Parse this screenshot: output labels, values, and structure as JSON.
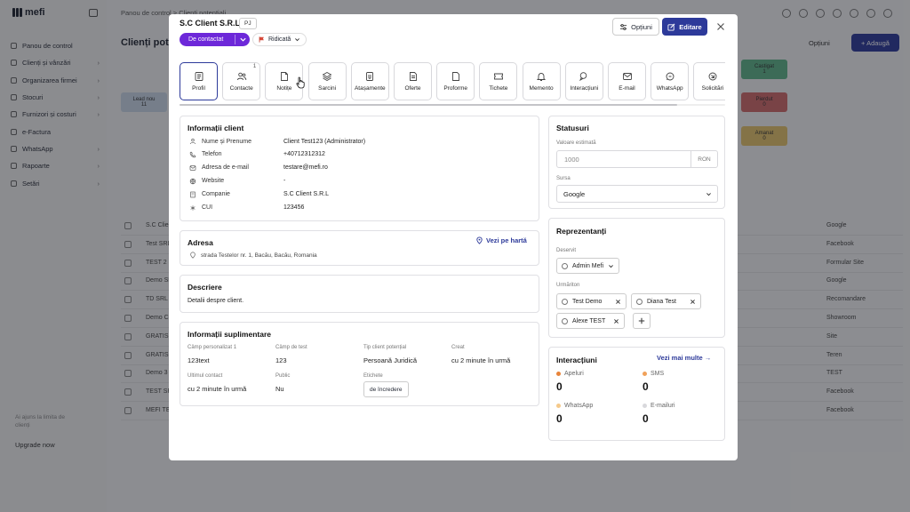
{
  "app": {
    "brand": "mefi",
    "breadcrumb": "Panou de control  >  Clienți potențiali",
    "page_title": "Clienți potențiali",
    "options_label": "Opțiuni",
    "add_label": "+ Adaugă",
    "upsell_text": "Ai ajuns la limita de clienți",
    "upgrade_label": "Upgrade now"
  },
  "sidebar": {
    "items": [
      {
        "label": "Panou de control",
        "icon": "dashboard-icon",
        "has_arrow": false
      },
      {
        "label": "Clienți și vânzări",
        "icon": "users-icon",
        "has_arrow": true
      },
      {
        "label": "Organizarea firmei",
        "icon": "building-icon",
        "has_arrow": true
      },
      {
        "label": "Stocuri",
        "icon": "box-icon",
        "has_arrow": true
      },
      {
        "label": "Furnizori și costuri",
        "icon": "truck-icon",
        "has_arrow": true
      },
      {
        "label": "e-Factura",
        "icon": "invoice-icon",
        "has_arrow": false
      },
      {
        "label": "WhatsApp",
        "icon": "whatsapp-icon",
        "has_arrow": true
      },
      {
        "label": "Rapoarte",
        "icon": "chart-icon",
        "has_arrow": true
      },
      {
        "label": "Setări",
        "icon": "gear-icon",
        "has_arrow": true
      }
    ]
  },
  "bg_cards": [
    {
      "label": "Lead nou",
      "count": "11",
      "color": "#c9d7e8"
    },
    {
      "label": "Castigat",
      "count": "1",
      "color": "#5fb38a"
    },
    {
      "label": "Pierdut",
      "count": "0",
      "color": "#d06a6a"
    },
    {
      "label": "Amanat",
      "count": "0",
      "color": "#e4c36b"
    }
  ],
  "bg_rows": [
    {
      "name": "S.C Client S.R.L",
      "source": "Google"
    },
    {
      "name": "Test SRL",
      "source": "Facebook"
    },
    {
      "name": "TEST 2 SRL",
      "source": "Formular Site"
    },
    {
      "name": "Demo SRL",
      "source": "Google"
    },
    {
      "name": "TD SRL",
      "source": "Recomandare"
    },
    {
      "name": "Demo Client",
      "source": "Showroom"
    },
    {
      "name": "GRATIS SRL",
      "source": "Site"
    },
    {
      "name": "GRATIS 2",
      "source": "Teren"
    },
    {
      "name": "Demo 3",
      "source": "TEST"
    },
    {
      "name": "TEST SRL",
      "source": "Facebook"
    },
    {
      "name": "MEFI TEST",
      "source": "Facebook"
    }
  ],
  "modal": {
    "title": "S.C Client S.R.L",
    "type_badge": "PJ",
    "status": "De contactat",
    "priority": "Ridicată",
    "options_label": "Opțiuni",
    "edit_label": "Editare",
    "tabs": [
      {
        "label": "Profil",
        "icon": "profile-icon",
        "active": true,
        "count": ""
      },
      {
        "label": "Contacte",
        "icon": "contacts-icon",
        "active": false,
        "count": "1"
      },
      {
        "label": "Notițe",
        "icon": "note-icon",
        "active": false,
        "count": ""
      },
      {
        "label": "Sarcini",
        "icon": "layers-icon",
        "active": false,
        "count": ""
      },
      {
        "label": "Atașamente",
        "icon": "attachment-icon",
        "active": false,
        "count": ""
      },
      {
        "label": "Oferte",
        "icon": "document-icon",
        "active": false,
        "count": ""
      },
      {
        "label": "Proforme",
        "icon": "file-icon",
        "active": false,
        "count": ""
      },
      {
        "label": "Tichete",
        "icon": "ticket-icon",
        "active": false,
        "count": ""
      },
      {
        "label": "Memento",
        "icon": "bell-icon",
        "active": false,
        "count": ""
      },
      {
        "label": "Interacțiuni",
        "icon": "chat-icon",
        "active": false,
        "count": ""
      },
      {
        "label": "E-mail",
        "icon": "mail-icon",
        "active": false,
        "count": ""
      },
      {
        "label": "WhatsApp",
        "icon": "whatsapp-icon",
        "active": false,
        "count": ""
      },
      {
        "label": "Solicitări",
        "icon": "request-icon",
        "active": false,
        "count": ""
      }
    ],
    "client_info": {
      "title": "Informații client",
      "rows": [
        {
          "key": "Nume și Prenume",
          "value": "Client Test123 (Administrator)",
          "icon": "person-icon"
        },
        {
          "key": "Telefon",
          "value": "+40712312312",
          "icon": "phone-icon"
        },
        {
          "key": "Adresa de e-mail",
          "value": "testare@mefi.ro",
          "icon": "mail-icon"
        },
        {
          "key": "Website",
          "value": "-",
          "icon": "globe-icon"
        },
        {
          "key": "Companie",
          "value": "S.C Client S.R.L",
          "icon": "building-icon"
        },
        {
          "key": "CUI",
          "value": "123456",
          "icon": "asterisk-icon"
        }
      ]
    },
    "address": {
      "title": "Adresa",
      "map_link": "Vezi pe hartă",
      "value": "strada Testelor nr. 1, Bacău, Bacău, Romania"
    },
    "description": {
      "title": "Descriere",
      "value": "Detalii despre client."
    },
    "extra": {
      "title": "Informații suplimentare",
      "fields": [
        {
          "label": "Câmp personalizat 1",
          "value": "123text"
        },
        {
          "label": "Câmp de test",
          "value": "123"
        },
        {
          "label": "Tip client potențial",
          "value": "Persoană Juridică"
        },
        {
          "label": "Creat",
          "value": "cu 2 minute în urmă"
        },
        {
          "label": "Ultimul contact",
          "value": "cu 2 minute în urmă"
        },
        {
          "label": "Public",
          "value": "Nu"
        },
        {
          "label": "Etichete",
          "value": "de încredere"
        }
      ]
    },
    "statuses": {
      "title": "Statusuri",
      "estimated_label": "Valoare estimată",
      "estimated_placeholder": "1000",
      "currency": "RON",
      "source_label": "Sursa",
      "source_value": "Google"
    },
    "reps": {
      "title": "Reprezentanți",
      "owner_label": "Deservit",
      "owner": "Admin Mefi",
      "followers_label": "Urmăriton",
      "followers": [
        "Test Demo",
        "Diana Test",
        "Alexe TEST"
      ]
    },
    "interactions": {
      "title": "Interacțiuni",
      "more_label": "Vezi mai multe",
      "stats": [
        {
          "label": "Apeluri",
          "value": "0",
          "color": "#e8843a"
        },
        {
          "label": "SMS",
          "value": "0",
          "color": "#f0a15a"
        },
        {
          "label": "WhatsApp",
          "value": "0",
          "color": "#f5c98a"
        },
        {
          "label": "E-mailuri",
          "value": "0",
          "color": "#d8d8dc"
        }
      ]
    }
  }
}
